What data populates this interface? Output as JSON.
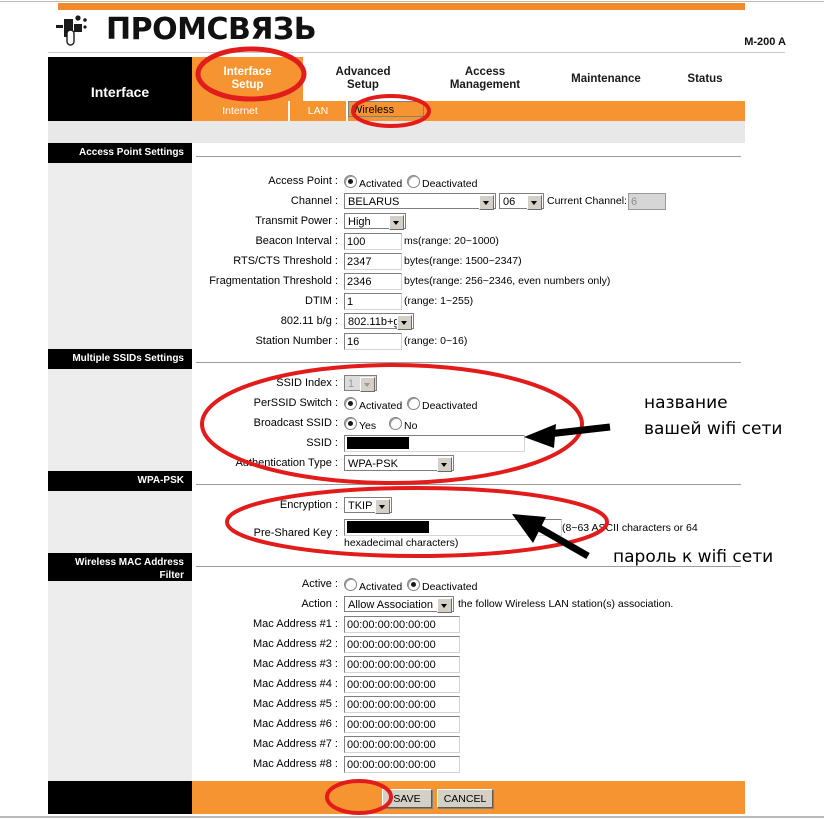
{
  "header": {
    "brand": "ПРОМСВЯЗЬ",
    "model": "M-200 A"
  },
  "nav": {
    "section_label": "Interface",
    "tabs": [
      {
        "label": "Interface\nSetup",
        "line1": "Interface",
        "line2": "Setup",
        "active": true
      },
      {
        "label": "Advanced Setup",
        "line1": "Advanced",
        "line2": "Setup",
        "active": false
      },
      {
        "label": "Access Management",
        "line1": "Access",
        "line2": "Management",
        "active": false
      },
      {
        "label": "Maintenance",
        "line1": "Maintenance",
        "line2": "",
        "active": false
      },
      {
        "label": "Status",
        "line1": "Status",
        "line2": "",
        "active": false
      }
    ],
    "subtabs": [
      {
        "label": "Internet",
        "selected": false
      },
      {
        "label": "LAN",
        "selected": false
      },
      {
        "label": "Wireless",
        "selected": true
      }
    ]
  },
  "sections": {
    "access_point": {
      "title": "Access Point Settings",
      "fields": {
        "access_point": {
          "label": "Access Point :",
          "options": [
            "Activated",
            "Deactivated"
          ],
          "selected": "Activated"
        },
        "channel": {
          "label": "Channel :",
          "country": "BELARUS",
          "channel_number": "06",
          "current_channel_label": "Current Channel:",
          "current_channel_value": "6"
        },
        "transmit_power": {
          "label": "Transmit Power :",
          "value": "High"
        },
        "beacon_interval": {
          "label": "Beacon Interval :",
          "value": "100",
          "hint": "ms(range: 20~1000)"
        },
        "rts_cts_threshold": {
          "label": "RTS/CTS Threshold :",
          "value": "2347",
          "hint": "bytes(range: 1500~2347)"
        },
        "fragmentation_threshold": {
          "label": "Fragmentation Threshold :",
          "value": "2346",
          "hint": "bytes(range: 256~2346, even numbers only)"
        },
        "dtim": {
          "label": "DTIM :",
          "value": "1",
          "hint": "(range: 1~255)"
        },
        "wireless_mode": {
          "label": "802.11 b/g :",
          "value": "802.11b+g"
        },
        "station_number": {
          "label": "Station Number :",
          "value": "16",
          "hint": "(range: 0~16)"
        }
      }
    },
    "multiple_ssids": {
      "title": "Multiple SSIDs Settings",
      "fields": {
        "ssid_index": {
          "label": "SSID Index :",
          "value": "1"
        },
        "per_ssid_switch": {
          "label": "PerSSID Switch :",
          "options": [
            "Activated",
            "Deactivated"
          ],
          "selected": "Activated"
        },
        "broadcast_ssid": {
          "label": "Broadcast SSID :",
          "options": [
            "Yes",
            "No"
          ],
          "selected": "Yes"
        },
        "ssid": {
          "label": "SSID :",
          "value": ""
        },
        "authentication_type": {
          "label": "Authentication Type :",
          "value": "WPA-PSK"
        }
      }
    },
    "wpa_psk": {
      "title": "WPA-PSK",
      "fields": {
        "encryption": {
          "label": "Encryption :",
          "value": "TKIP"
        },
        "pre_shared_key": {
          "label": "Pre-Shared Key :",
          "value": "",
          "hint_line1": "(8~63 ASCII characters or 64",
          "hint_line2": "hexadecimal characters)"
        }
      }
    },
    "mac_filter": {
      "title_line1": "Wireless MAC Address",
      "title_line2": "Filter",
      "fields": {
        "active": {
          "label": "Active :",
          "options": [
            "Activated",
            "Deactivated"
          ],
          "selected": "Deactivated"
        },
        "action": {
          "label": "Action :",
          "value": "Allow Association",
          "hint": "the follow Wireless LAN station(s) association."
        }
      },
      "mac_rows": [
        {
          "label": "Mac Address #1 :",
          "value": "00:00:00:00:00:00"
        },
        {
          "label": "Mac Address #2 :",
          "value": "00:00:00:00:00:00"
        },
        {
          "label": "Mac Address #3 :",
          "value": "00:00:00:00:00:00"
        },
        {
          "label": "Mac Address #4 :",
          "value": "00:00:00:00:00:00"
        },
        {
          "label": "Mac Address #5 :",
          "value": "00:00:00:00:00:00"
        },
        {
          "label": "Mac Address #6 :",
          "value": "00:00:00:00:00:00"
        },
        {
          "label": "Mac Address #7 :",
          "value": "00:00:00:00:00:00"
        },
        {
          "label": "Mac Address #8 :",
          "value": "00:00:00:00:00:00"
        }
      ]
    }
  },
  "footer": {
    "save_label": "SAVE",
    "cancel_label": "CANCEL"
  },
  "annotations": {
    "ssid_note_line1": "название",
    "ssid_note_line2": "вашей wifi сети",
    "psk_note": "пароль к wifi сети",
    "highlight_color": "#e21b1b"
  }
}
